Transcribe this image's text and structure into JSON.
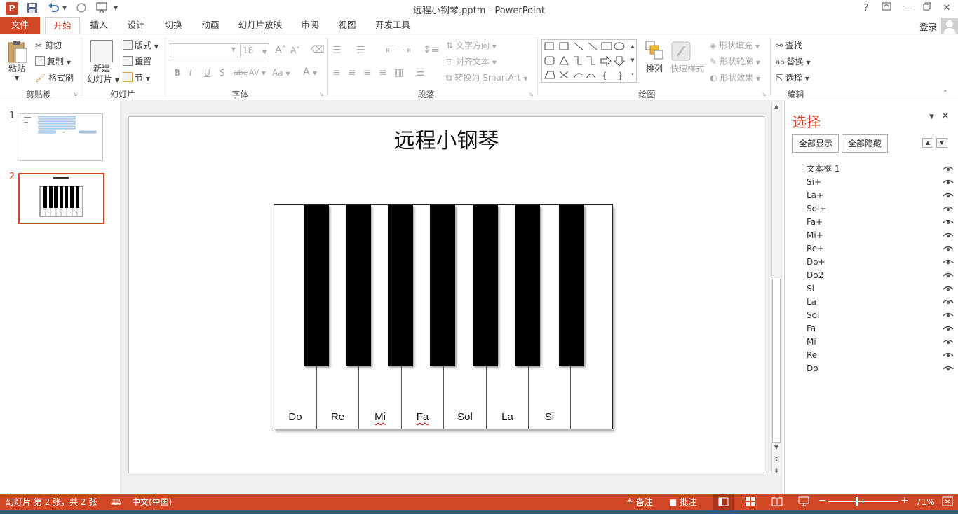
{
  "window": {
    "title": "远程小钢琴.pptm - PowerPoint",
    "help": "?",
    "minimize": "—"
  },
  "quick_access": {
    "save": "save-icon",
    "undo": "undo-icon",
    "redo": "redo-icon",
    "present": "present-icon"
  },
  "tabs": [
    "文件",
    "开始",
    "插入",
    "设计",
    "切换",
    "动画",
    "幻灯片放映",
    "审阅",
    "视图",
    "开发工具"
  ],
  "login": "登录",
  "ribbon": {
    "clipboard": {
      "paste": "粘贴",
      "cut": "剪切",
      "copy": "复制",
      "format_painter": "格式刷",
      "label": "剪贴板"
    },
    "slides": {
      "new_slide_1": "新建",
      "new_slide_2": "幻灯片",
      "layout": "版式",
      "reset": "重置",
      "section": "节",
      "label": "幻灯片"
    },
    "font": {
      "font_name": "",
      "font_size": "18",
      "label": "字体",
      "bold": "B",
      "italic": "I",
      "underline": "U",
      "shadow": "S",
      "strike": "abc",
      "spacing": "AV",
      "case": "Aa",
      "color": "A"
    },
    "paragraph": {
      "text_direction": "文字方向",
      "align_text": "对齐文本",
      "smartart": "转换为 SmartArt",
      "label": "段落"
    },
    "drawing": {
      "arrange": "排列",
      "quick_styles": "快速样式",
      "shape_fill": "形状填充",
      "shape_outline": "形状轮廓",
      "shape_effects": "形状效果",
      "label": "绘图"
    },
    "editing": {
      "find": "查找",
      "replace": "替换",
      "select": "选择",
      "label": "编辑"
    }
  },
  "thumbnails": [
    {
      "number": "1"
    },
    {
      "number": "2"
    }
  ],
  "slide": {
    "title": "远程小钢琴",
    "white_keys": [
      "Do",
      "Re",
      "Mi",
      "Fa",
      "Sol",
      "La",
      "Si",
      ""
    ]
  },
  "selection_pane": {
    "title": "选择",
    "show_all": "全部显示",
    "hide_all": "全部隐藏",
    "items": [
      "文本框 1",
      "Si+",
      "La+",
      "Sol+",
      "Fa+",
      "Mi+",
      "Re+",
      "Do+",
      "Do2",
      "Si",
      "La",
      "Sol",
      "Fa",
      "Mi",
      "Re",
      "Do"
    ]
  },
  "status": {
    "slide_info": "幻灯片 第 2 张，共 2 张",
    "language": "中文(中国)",
    "notes": "备注",
    "comments": "批注",
    "zoom": "71%",
    "zoom_level": 0.4
  },
  "colors": {
    "accent": "#d24726",
    "ribbon_border": "#d4d4d4"
  }
}
